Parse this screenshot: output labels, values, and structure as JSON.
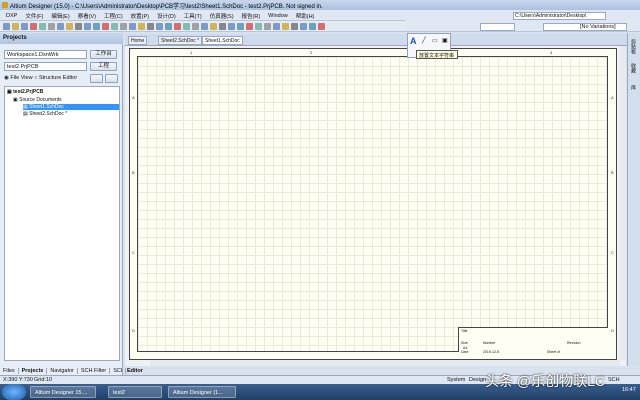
{
  "window": {
    "title": "Altium Designer (15.0) - C:\\Users\\Administrator\\Desktop\\PCB学习\\test2\\Sheet1.SchDoc - test2.PrjPCB. Not signed in."
  },
  "menu": [
    "DXP",
    "文件(F)",
    "编辑(E)",
    "察看(V)",
    "工程(C)",
    "放置(P)",
    "设计(D)",
    "工具(T)",
    "仿真器(S)",
    "报告(R)",
    "Window",
    "帮助(H)"
  ],
  "toolbar": {
    "path": "C:\\Users\\Administrator\\Desktop\\",
    "variations": "[No Variations]"
  },
  "projects": {
    "title": "Projects",
    "workspace": "Workspace1.DsnWrk",
    "workspace_btn": "工作台",
    "project": "test2.PrjPCB",
    "project_btn": "工程",
    "view_file": "File View",
    "view_structure": "Structure Editor"
  },
  "tree": {
    "root": "test2.PrjPCB",
    "folder": "Source Documents",
    "doc1": "Sheet1.SchDoc",
    "doc2": "Sheet2.SchDoc *"
  },
  "panel_tabs": [
    "Files",
    "Projects",
    "Navigator",
    "SCH Filter",
    "SCI"
  ],
  "doc_tabs": [
    "Home",
    "Sheet2.SchDoc *",
    "Sheet1.SchDoc"
  ],
  "popup": {
    "tooltip": "放置文本字符串"
  },
  "right_panel": [
    "剪贴板",
    "收藏",
    "库"
  ],
  "sheet": {
    "zones_x": [
      "1",
      "2",
      "3",
      "4"
    ],
    "zones_y": [
      "A",
      "B",
      "C",
      "D"
    ],
    "title": "Title",
    "size": "Size",
    "size_val": "A4",
    "number": "Number",
    "revision": "Revision",
    "date": "Date",
    "date_val": "2019-12-5",
    "sheet_of": "Sheet of"
  },
  "editor": "Editor",
  "status": {
    "coords": "X:390 Y:730",
    "grid": "Grid:10",
    "system": "System",
    "design": "Design",
    "sch": "SCH"
  },
  "taskbar": {
    "items": [
      "Altium Designer 15....",
      "test2",
      "Altium Designer (1..."
    ],
    "clock": "16:47"
  },
  "watermark": "头条 @乐创物联LC",
  "colors": {
    "accent": "#3393ff",
    "title": "#a9c0de"
  }
}
